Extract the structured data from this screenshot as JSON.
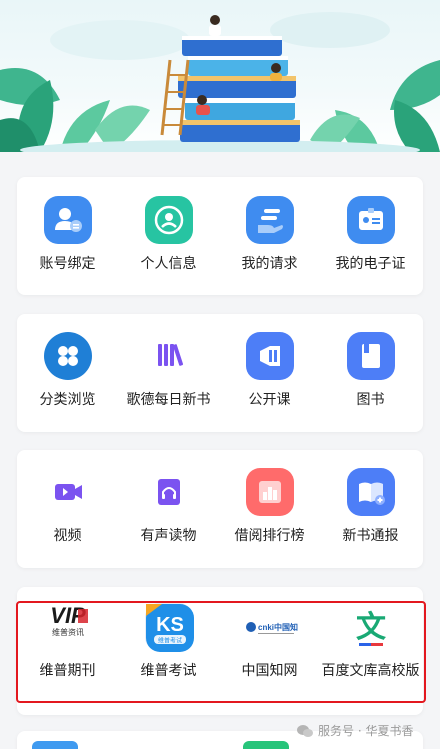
{
  "rows": [
    [
      {
        "name": "account-binding-button",
        "icon": "user-card-icon",
        "label": "账号绑定",
        "color": "#3f8cf0"
      },
      {
        "name": "personal-info-button",
        "icon": "person-icon",
        "label": "个人信息",
        "color": "#27c4a2"
      },
      {
        "name": "my-requests-button",
        "icon": "hand-request-icon",
        "label": "我的请求",
        "color": "#3f8cf0"
      },
      {
        "name": "my-ecard-button",
        "icon": "id-card-icon",
        "label": "我的电子证",
        "color": "#3f8cf0"
      }
    ],
    [
      {
        "name": "category-browse-button",
        "icon": "grid-icon",
        "label": "分类浏览",
        "color": "#1f7fd6"
      },
      {
        "name": "goethe-daily-books-button",
        "icon": "books-icon",
        "label": "歌德每日新书",
        "color": "#7b53f0"
      },
      {
        "name": "open-course-button",
        "icon": "speaker-icon",
        "label": "公开课",
        "color": "#4d7ef7"
      },
      {
        "name": "books-button",
        "icon": "book-icon",
        "label": "图书",
        "color": "#4d7ef7"
      }
    ],
    [
      {
        "name": "video-button",
        "icon": "video-icon",
        "label": "视频",
        "color": "#7b53f0"
      },
      {
        "name": "audiobook-button",
        "icon": "headphone-book-icon",
        "label": "有声读物",
        "color": "#7b53f0"
      },
      {
        "name": "borrow-ranking-button",
        "icon": "bar-chart-icon",
        "label": "借阅排行榜",
        "color": "#ff6b6b"
      },
      {
        "name": "new-book-notice-button",
        "icon": "open-book-icon",
        "label": "新书通报",
        "color": "#4d7ef7"
      }
    ],
    [
      {
        "name": "vip-journals-button",
        "icon": "vip-logo-icon",
        "label": "维普期刊",
        "logo_text": "VIP",
        "logo_sub": "维普资讯"
      },
      {
        "name": "vip-exam-button",
        "icon": "ks-logo-icon",
        "label": "维普考试",
        "logo_text": "KS",
        "logo_sub": "维普考试"
      },
      {
        "name": "cnki-button",
        "icon": "cnki-logo-icon",
        "label": "中国知网",
        "logo_text": "cnki中国知网"
      },
      {
        "name": "baidu-wenku-button",
        "icon": "wenku-logo-icon",
        "label": "百度文库高校版",
        "logo_text": "文"
      }
    ]
  ],
  "watermark": {
    "text": "服务号 · 华夏书香"
  }
}
